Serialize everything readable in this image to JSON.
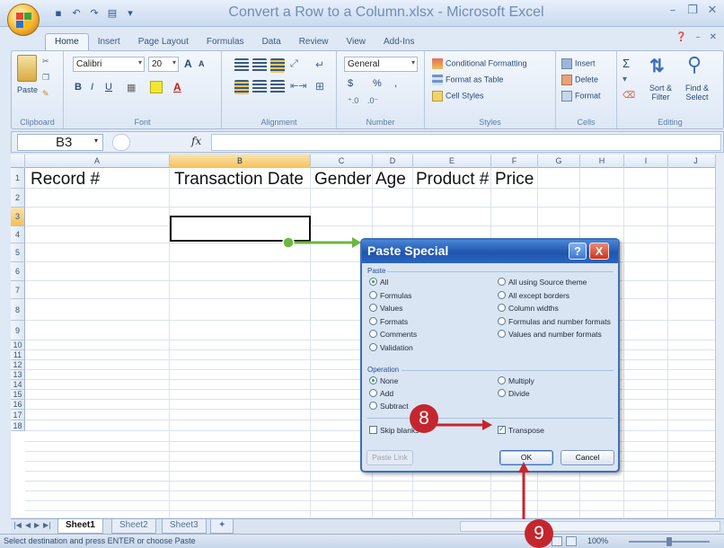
{
  "window": {
    "title": "Convert a Row to a Column.xlsx - Microsoft Excel"
  },
  "ribbon": {
    "tabs": [
      {
        "label": "Home",
        "active": true
      },
      {
        "label": "Insert"
      },
      {
        "label": "Page Layout"
      },
      {
        "label": "Formulas"
      },
      {
        "label": "Data"
      },
      {
        "label": "Review"
      },
      {
        "label": "View"
      },
      {
        "label": "Add-Ins"
      }
    ],
    "groups": {
      "clipboard": {
        "label": "Clipboard",
        "paste": "Paste"
      },
      "font": {
        "label": "Font",
        "font_name": "Calibri",
        "font_size": "20",
        "bold": "B",
        "italic": "I",
        "underline": "U",
        "grow": "A",
        "shrink": "A"
      },
      "alignment": {
        "label": "Alignment"
      },
      "number": {
        "label": "Number",
        "format": "General",
        "currency": "$",
        "percent": "%",
        "comma": ","
      },
      "styles": {
        "label": "Styles",
        "conditional": "Conditional Formatting",
        "table": "Format as Table",
        "cell_styles": "Cell Styles"
      },
      "cells": {
        "label": "Cells",
        "insert": "Insert",
        "delete": "Delete",
        "format": "Format"
      },
      "editing": {
        "label": "Editing",
        "sort": "Sort &",
        "filter": "Filter",
        "find": "Find &",
        "select": "Select",
        "sigma": "Σ"
      }
    }
  },
  "formula_bar": {
    "name_box": "B3",
    "fx": "fx",
    "value": ""
  },
  "grid": {
    "columns": [
      "A",
      "B",
      "C",
      "D",
      "E",
      "F",
      "G",
      "H",
      "I",
      "J"
    ],
    "selected_column": "B",
    "rows": [
      "1",
      "2",
      "3",
      "4",
      "5",
      "6",
      "7",
      "8",
      "9",
      "10",
      "11",
      "12",
      "13",
      "14",
      "15",
      "16",
      "17",
      "18"
    ],
    "selected_row": "3",
    "row1_cells": [
      "Record #",
      "Transaction Date",
      "Gender",
      "Age",
      "Product #",
      "Price"
    ]
  },
  "sheets": {
    "tabs": [
      "Sheet1",
      "Sheet2",
      "Sheet3"
    ],
    "active": "Sheet1"
  },
  "status": {
    "message": "Select destination and press ENTER or choose Paste",
    "zoom": "100%"
  },
  "dialog": {
    "title": "Paste Special",
    "help": "?",
    "close": "X",
    "paste_section": "Paste",
    "paste_options_left": [
      {
        "label": "All",
        "checked": true
      },
      {
        "label": "Formulas"
      },
      {
        "label": "Values"
      },
      {
        "label": "Formats"
      },
      {
        "label": "Comments"
      },
      {
        "label": "Validation"
      }
    ],
    "paste_options_right": [
      {
        "label": "All using Source theme"
      },
      {
        "label": "All except borders"
      },
      {
        "label": "Column widths"
      },
      {
        "label": "Formulas and number formats"
      },
      {
        "label": "Values and number formats"
      }
    ],
    "operation_section": "Operation",
    "operation_left": [
      {
        "label": "None",
        "checked": true
      },
      {
        "label": "Add"
      },
      {
        "label": "Subtract"
      }
    ],
    "operation_right": [
      {
        "label": "Multiply"
      },
      {
        "label": "Divide"
      }
    ],
    "skip_blanks": {
      "label": "Skip blanks",
      "checked": false
    },
    "transpose": {
      "label": "Transpose",
      "checked": true
    },
    "buttons": {
      "paste_link": "Paste Link",
      "ok": "OK",
      "cancel": "Cancel"
    }
  },
  "callouts": [
    "8",
    "9"
  ],
  "colors": {
    "callout": "#c4262e",
    "arrow_red": "#c4262e",
    "arrow_green": "#6ab83c",
    "dialog_title": "#1f55ad"
  }
}
